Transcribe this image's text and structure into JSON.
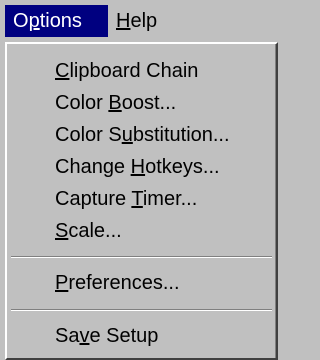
{
  "menubar": {
    "options": {
      "pre": "O",
      "ul": "p",
      "post": "tions"
    },
    "help": {
      "pre": "",
      "ul": "H",
      "post": "elp"
    }
  },
  "dropdown": {
    "items": [
      {
        "pre": "",
        "ul": "C",
        "post": "lipboard Chain"
      },
      {
        "pre": "Color ",
        "ul": "B",
        "post": "oost..."
      },
      {
        "pre": "Color S",
        "ul": "u",
        "post": "bstitution..."
      },
      {
        "pre": "Change ",
        "ul": "H",
        "post": "otkeys..."
      },
      {
        "pre": "Capture ",
        "ul": "T",
        "post": "imer..."
      },
      {
        "pre": "",
        "ul": "S",
        "post": "cale..."
      },
      {
        "pre": "",
        "ul": "P",
        "post": "references..."
      },
      {
        "pre": "Sa",
        "ul": "v",
        "post": "e Setup"
      }
    ]
  }
}
